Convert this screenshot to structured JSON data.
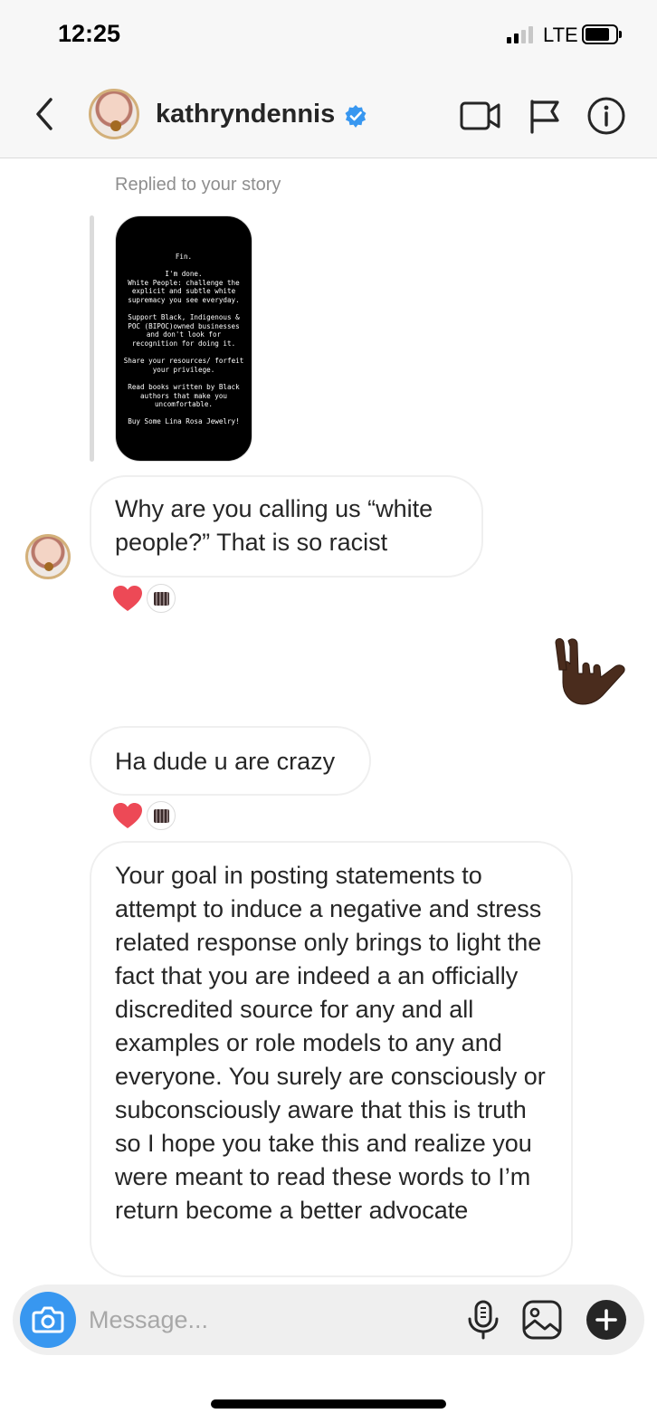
{
  "status_bar": {
    "time": "12:25",
    "network": "LTE"
  },
  "header": {
    "username": "kathryndennis",
    "verified": true,
    "icons": [
      "back-chevron-icon",
      "video-call-icon",
      "flag-icon",
      "info-icon"
    ]
  },
  "thread": {
    "reply_label": "Replied to your story",
    "story_text": "Fin.\n\nI'm done.\nWhite People: challenge the explicit and subtle white supremacy you see everyday.\n\nSupport Black, Indigenous & POC (BIPOC)owned businesses and don't look for recognition for doing it.\n\nShare your resources/ forfeit your privilege.\n\nRead books written by Black authors that make you uncomfortable.\n\nBuy Some Lina Rosa Jewelry!",
    "messages": [
      {
        "text": "Why are you calling us “white people?” That is so racist",
        "reactions": [
          "heart",
          "avatar"
        ]
      },
      {
        "text": "Ha dude u are crazy",
        "reactions": [
          "heart",
          "avatar"
        ]
      },
      {
        "text": "Your goal in posting statements to attempt to induce a negative and stress related response only brings to light the fact that you are indeed a an officially discredited source for any and all examples or role models to any and everyone. You surely are consciously or subconsciously aware that this is truth so I hope you take this and realize you were meant to read these words to I’m return become a better advocate"
      }
    ],
    "sent_emoji": "🤟🏿"
  },
  "composer": {
    "placeholder": "Message...",
    "icons": [
      "camera-icon",
      "microphone-icon",
      "gallery-icon",
      "plus-icon"
    ]
  },
  "colors": {
    "accent": "#3897f0",
    "heart": "#ed4956",
    "bubble_border": "#efefef"
  }
}
